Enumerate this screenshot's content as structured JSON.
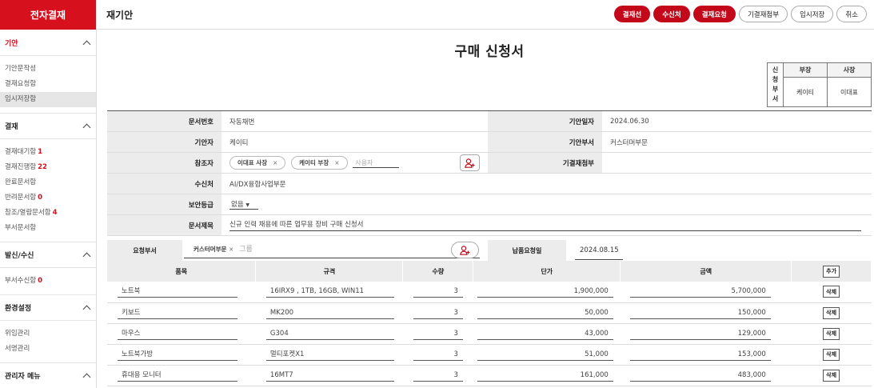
{
  "app": {
    "brand": "전자결재",
    "page_title": "재기안"
  },
  "toolbar": {
    "buttons": [
      "결재선",
      "수신처",
      "결재요청",
      "기결재첨부",
      "임시저장",
      "취소"
    ]
  },
  "sidebar": {
    "sections": [
      {
        "title": "기안",
        "items": [
          {
            "label": "기안문작성",
            "count": ""
          },
          {
            "label": "결재요청함",
            "count": ""
          },
          {
            "label": "임시저장함",
            "count": ""
          }
        ]
      },
      {
        "title": "결재",
        "items": [
          {
            "label": "결재대기함",
            "count": "1"
          },
          {
            "label": "결재진행함",
            "count": "22"
          },
          {
            "label": "완료문서함",
            "count": ""
          },
          {
            "label": "반려문서함",
            "count": "0"
          },
          {
            "label": "참조/열람문서함",
            "count": "4"
          },
          {
            "label": "부서문서함",
            "count": ""
          }
        ]
      },
      {
        "title": "발신/수신",
        "items": [
          {
            "label": "부서수신함",
            "count": "0"
          }
        ]
      },
      {
        "title": "환경설정",
        "items": [
          {
            "label": "위임관리",
            "count": ""
          },
          {
            "label": "서명관리",
            "count": ""
          }
        ]
      },
      {
        "title": "관리자 메뉴",
        "items": []
      }
    ]
  },
  "document": {
    "title": "구매 신청서",
    "approval": {
      "label": "신청부서",
      "headers": [
        "부장",
        "사장"
      ],
      "values": [
        "케이티",
        "이대표"
      ]
    },
    "fields": {
      "doc_no_label": "문서번호",
      "doc_no": "자동채번",
      "draft_date_label": "기안일자",
      "draft_date": "2024.06.30",
      "drafter_label": "기안자",
      "drafter": "케이티",
      "draft_dept_label": "기안부서",
      "draft_dept": "커스터머부문",
      "cc_label": "참조자",
      "cc_chips": [
        "이대표 사장",
        "케이티 부장"
      ],
      "cc_placeholder": "사용자",
      "attach_label": "기결재첨부",
      "recipient_label": "수신처",
      "recipient": "AI/DX융합사업부문",
      "security_label": "보안등급",
      "security": "없음",
      "subject_label": "문서제목",
      "subject": "신규 인력 채용에 따른 업무용 장비 구매 신청서"
    },
    "request": {
      "dept_label": "요청부서",
      "dept_chip": "커스터머부문",
      "group_placeholder": "그룹",
      "due_label": "납품요청일",
      "due_date": "2024.08.15"
    },
    "items": {
      "headers": [
        "품목",
        "규격",
        "수량",
        "단가",
        "금액"
      ],
      "add_label": "추가",
      "delete_label": "삭제",
      "rows": [
        {
          "name": "노트북",
          "spec": "16IRX9 , 1TB, 16GB, WIN11",
          "qty": "3",
          "price": "1,900,000",
          "amount": "5,700,000"
        },
        {
          "name": "키보드",
          "spec": "MK200",
          "qty": "3",
          "price": "50,000",
          "amount": "150,000"
        },
        {
          "name": "마우스",
          "spec": "G304",
          "qty": "3",
          "price": "43,000",
          "amount": "129,000"
        },
        {
          "name": "노트북가방",
          "spec": "멀티포켓X1",
          "qty": "3",
          "price": "51,000",
          "amount": "153,000"
        },
        {
          "name": "휴대용 모니터",
          "spec": "16MT7",
          "qty": "3",
          "price": "161,000",
          "amount": "483,000"
        }
      ]
    }
  },
  "colors": {
    "brand_red": "#d7101e",
    "button_red": "#c3081a"
  }
}
